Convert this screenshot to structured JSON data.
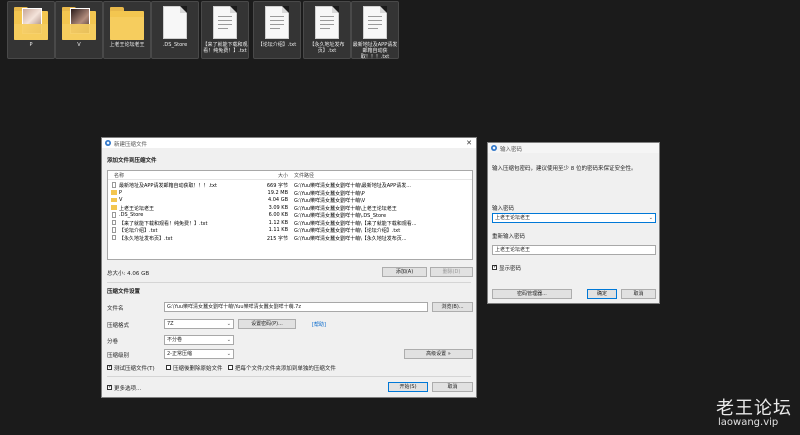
{
  "desktop": {
    "items": [
      {
        "label": "P",
        "kind": "folder"
      },
      {
        "label": "V",
        "kind": "folder"
      },
      {
        "label": "上老王论坛老王",
        "kind": "folder"
      },
      {
        "label": ".DS_Store",
        "kind": "file"
      },
      {
        "label": "【来了就能下载和观看！纯免费！】.txt",
        "kind": "file"
      },
      {
        "label": "【论坛介绍】.txt",
        "kind": "file"
      },
      {
        "label": "【永久地址发布页】.txt",
        "kind": "file"
      },
      {
        "label": "最新地址及APP请发邮箱自动获取！！！.txt",
        "kind": "file"
      }
    ]
  },
  "archive_dialog": {
    "title": "新建压缩文件",
    "close": "✕",
    "section_add": "添加文件到压缩文件",
    "columns": {
      "name": "名称",
      "size": "大小",
      "path": "文件路径"
    },
    "files": [
      {
        "name": "最新地址及APP请发邮箱自动获取！！！.txt",
        "size": "669 字节",
        "path": "G:\\Yuu樂咩清女蠶女劉咩十萌\\最新地址及APP请发...",
        "kind": "file"
      },
      {
        "name": "P",
        "size": "19.2 MB",
        "path": "G:\\Yuu樂咩清女蠶女劉咩十萌\\P",
        "kind": "folder"
      },
      {
        "name": "V",
        "size": "4.04 GB",
        "path": "G:\\Yuu樂咩清女蠶女劉咩十萌\\V",
        "kind": "folder"
      },
      {
        "name": "上老王论坛老王",
        "size": "3.09 KB",
        "path": "G:\\Yuu樂咩清女蠶女劉咩十萌\\上老王论坛老王",
        "kind": "folder"
      },
      {
        "name": ".DS_Store",
        "size": "6.00 KB",
        "path": "G:\\Yuu樂咩清女蠶女劉咩十萌\\.DS_Store",
        "kind": "file"
      },
      {
        "name": "【来了就能下载和观看！纯免费！】.txt",
        "size": "1.12 KB",
        "path": "G:\\Yuu樂咩清女蠶女劉咩十萌\\【来了就能下载和观看...",
        "kind": "file"
      },
      {
        "name": "【论坛介绍】.txt",
        "size": "1.11 KB",
        "path": "G:\\Yuu樂咩清女蠶女劉咩十萌\\【论坛介绍】.txt",
        "kind": "file"
      },
      {
        "name": "【永久地址发布页】.txt",
        "size": "215 字节",
        "path": "G:\\Yuu樂咩清女蠶女劉咩十萌\\【永久地址发布页...",
        "kind": "file"
      }
    ],
    "total_size": "总大小: 4.06 GB",
    "add_button": "添加(A)",
    "delete_button": "删除(D)",
    "section_settings": "压缩文件设置",
    "filename_label": "文件名",
    "filename_value": "G:\\Yuu樂咩清女蠶女劉咩十萌\\Yuu樂咩清女蠶女劉咩十萌.7z",
    "browse_button": "浏览(B)...",
    "format_label": "压缩格式",
    "format_value": "7Z",
    "set_password_button": "设置密码(P)...",
    "help_link": "[帮助]",
    "split_label": "分卷",
    "split_value": "不分卷",
    "level_label": "压缩级别",
    "level_value": "2-正常压缩",
    "advanced_button": "高级设置 »",
    "opt_test": "测试压缩文件(T)",
    "opt_delete_src": "压缩後删除原始文件",
    "opt_each_file": "把每个文件/文件夹添加到单独的压缩文件",
    "more_options": "更多选项...",
    "start_button": "开始(S)",
    "cancel_button": "取消"
  },
  "password_dialog": {
    "title": "输入密码",
    "hint": "输入压缩包密码，建议使用至少 8 位的密码来保证安全性。",
    "enter_label": "输入密码",
    "enter_value": "上老王论坛老王",
    "reenter_label": "重新输入密码",
    "reenter_value": "上老王论坛老王",
    "show_password": "显示密码",
    "manager_button": "密码管理器...",
    "ok_button": "确定",
    "cancel_button": "取消"
  },
  "watermark": {
    "main": "老王论坛",
    "sub": "laowang.vip"
  },
  "colors": {
    "desktop_bg": "#1b1b1b",
    "dialog_bg": "#f0f0f0",
    "accent": "#0078d7",
    "folder": "#f3c650"
  }
}
